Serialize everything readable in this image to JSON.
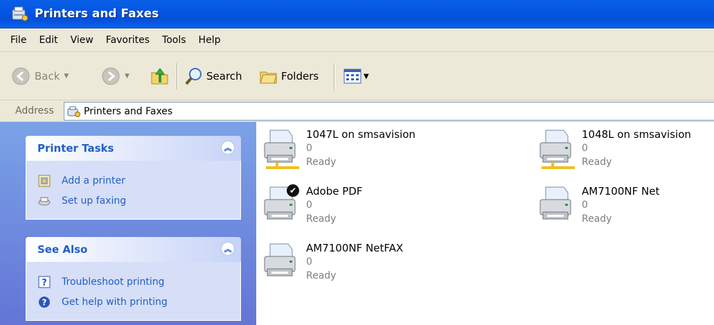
{
  "window": {
    "title": "Printers and Faxes"
  },
  "menu": [
    "File",
    "Edit",
    "View",
    "Favorites",
    "Tools",
    "Help"
  ],
  "toolbar": {
    "back_label": "Back",
    "search_label": "Search",
    "folders_label": "Folders"
  },
  "address": {
    "label": "Address",
    "value": "Printers and Faxes"
  },
  "tasks_panel": {
    "title": "Printer Tasks",
    "items": [
      {
        "label": "Add a printer",
        "icon": "add-printer-icon"
      },
      {
        "label": "Set up faxing",
        "icon": "fax-icon"
      }
    ]
  },
  "see_also_panel": {
    "title": "See Also",
    "items": [
      {
        "label": "Troubleshoot printing",
        "icon": "help-question-icon"
      },
      {
        "label": "Get help with printing",
        "icon": "help-circle-icon"
      }
    ]
  },
  "printers": [
    {
      "name": "1047L on smsavision",
      "documents": "0",
      "status": "Ready",
      "networked": true,
      "default": false
    },
    {
      "name": "1048L on smsavision",
      "documents": "0",
      "status": "Ready",
      "networked": true,
      "default": false
    },
    {
      "name": "Adobe PDF",
      "documents": "0",
      "status": "Ready",
      "networked": false,
      "default": true
    },
    {
      "name": "AM7100NF Net",
      "documents": "0",
      "status": "Ready",
      "networked": false,
      "default": false
    },
    {
      "name": "AM7100NF NetFAX",
      "documents": "0",
      "status": "Ready",
      "networked": false,
      "default": false
    }
  ],
  "colors": {
    "title_bar": "#0456e3",
    "task_link": "#215dc6",
    "pane_bg": "#7ba2e7"
  }
}
